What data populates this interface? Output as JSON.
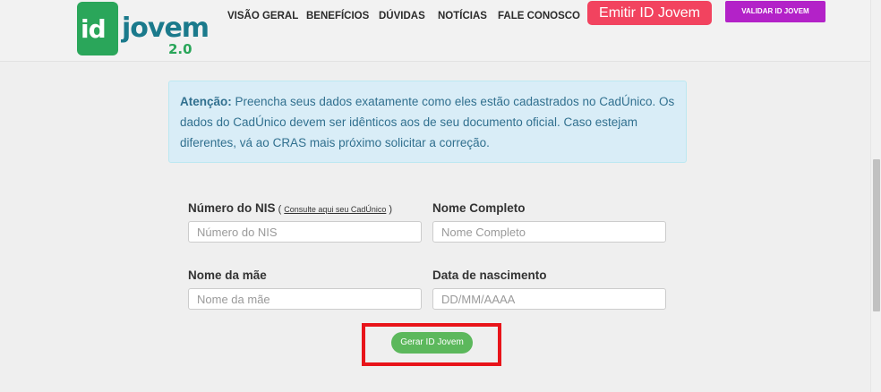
{
  "header": {
    "logo": {
      "id": "id",
      "jovem": "jovem",
      "version": "2.0"
    },
    "nav": [
      "VISÃO GERAL",
      "BENEFÍCIOS",
      "DÚVIDAS",
      "NOTÍCIAS",
      "FALE CONOSCO"
    ],
    "emitir_label": "Emitir ID Jovem",
    "validar_label": "VALIDAR ID JOVEM"
  },
  "alert": {
    "strong": "Atenção:",
    "text": " Preencha seus dados exatamente como eles estão cadastrados no CadÚnico. Os dados do CadÚnico devem ser idênticos aos de seu documento oficial. Caso estejam diferentes, vá ao CRAS mais próximo solicitar a correção."
  },
  "form": {
    "nis": {
      "label": "Número do NIS",
      "paren_open": " ( ",
      "link": "Consulte aqui seu CadÚnico",
      "paren_close": " )",
      "placeholder": "Número do NIS"
    },
    "nome": {
      "label": "Nome Completo",
      "placeholder": "Nome Completo"
    },
    "mae": {
      "label": "Nome da mãe",
      "placeholder": "Nome da mãe"
    },
    "nascimento": {
      "label": "Data de nascimento",
      "placeholder": "DD/MM/AAAA"
    },
    "submit_label": "Gerar ID Jovem"
  },
  "colors": {
    "emitir": "#f2435f",
    "validar": "#b322c8",
    "submit": "#5cb85c",
    "highlight": "#e8141a",
    "alert_bg": "#d9edf7"
  }
}
